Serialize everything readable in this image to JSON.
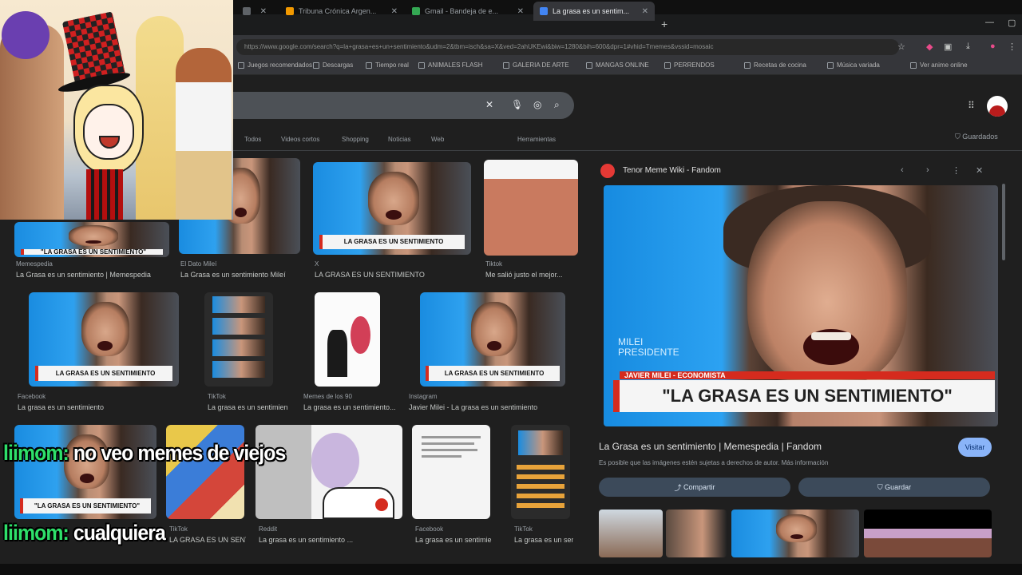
{
  "browser": {
    "tabs": [
      {
        "label": "Tribuna Crónica Argen...",
        "color": "#f29900",
        "active": false
      },
      {
        "label": "Gmail - Bandeja de e...",
        "color": "#34a853",
        "active": false
      },
      {
        "label": "La grasa es un sentim...",
        "color": "#4285f4",
        "active": true
      }
    ],
    "new_tab": "+",
    "url": "https://www.google.com/search?q=la+grasa+es+un+sentimiento&udm=2&tbm=isch&sa=X&ved=2ahUKEwi&biw=1280&bih=600&dpr=1#vhid=Tmemes&vssid=mosaic",
    "bookmarks": [
      "Juegos recomendados",
      "Descargas",
      "Tiempo real",
      "ANIMALES FLASH",
      "GALERIA DE ARTE",
      "MANGAS ONLINE",
      "PERRENDOS",
      "Recetas de cocina",
      "Música variada",
      "Ver anime online"
    ]
  },
  "google": {
    "filters": [
      "Todos",
      "Videos cortos",
      "Shopping",
      "Noticias",
      "Web",
      "Herramientas"
    ],
    "saved": "Guardados"
  },
  "results": [
    {
      "caption": "\"LA GRASA ES UN SENTIMIENTO\"",
      "source": "Memespedia",
      "title": "La Grasa es un sentimiento | Memespedia"
    },
    {
      "caption": "",
      "source": "El Dato Mileí",
      "title": "La Grasa es un sentimiento Mileí"
    },
    {
      "caption": "LA GRASA ES UN SENTIMIENTO",
      "source": "X",
      "title": "LA GRASA ES UN SENTIMIENTO"
    },
    {
      "caption": "",
      "source": "Tiktok",
      "title": "Me salió justo el mejor..."
    },
    {
      "caption": "LA GRASA ES UN SENTIMIENTO",
      "source": "Facebook",
      "title": "La grasa es un sentimiento"
    },
    {
      "caption": "",
      "source": "TikTok",
      "title": "La grasa es un sentimiento"
    },
    {
      "caption": "",
      "source": "Memes de los 90",
      "title": "La grasa es un sentimiento..."
    },
    {
      "caption": "LA GRASA ES UN SENTIMIENTO",
      "source": "Instagram",
      "title": "Javier Milei - La grasa es un sentimiento"
    },
    {
      "caption": "\"LA GRASA ES UN SENTIMIENTO\"",
      "source": "",
      "title": ""
    },
    {
      "caption": "",
      "source": "TikTok",
      "title": "LA GRASA ES UN SENTIMIENTO"
    },
    {
      "caption": "",
      "source": "Reddit",
      "title": "La grasa es un sentimiento ..."
    },
    {
      "caption": "",
      "source": "Facebook",
      "title": "La grasa es un sentimiento"
    },
    {
      "caption": "",
      "source": "TikTok",
      "title": "La grasa es un sentimiento"
    }
  ],
  "panel": {
    "source": "Tenor Meme Wiki - Fandom",
    "network": "MILEI\nPRESIDENTE",
    "lower_third": "JAVIER MILEI - ECONOMISTA",
    "headline": "\"LA GRASA ES UN SENTIMIENTO\"",
    "title": "La Grasa es un sentimiento | Memespedia | Fandom",
    "subtitle": "Es posible que las imágenes estén sujetas a derechos de autor. Más información",
    "visit": "Visitar",
    "share": "Compartir",
    "save": "Guardar"
  },
  "chat": [
    {
      "user": "liimom:",
      "message": "no veo memes de viejos"
    },
    {
      "user": "liimom:",
      "message": "cualquiera"
    }
  ]
}
